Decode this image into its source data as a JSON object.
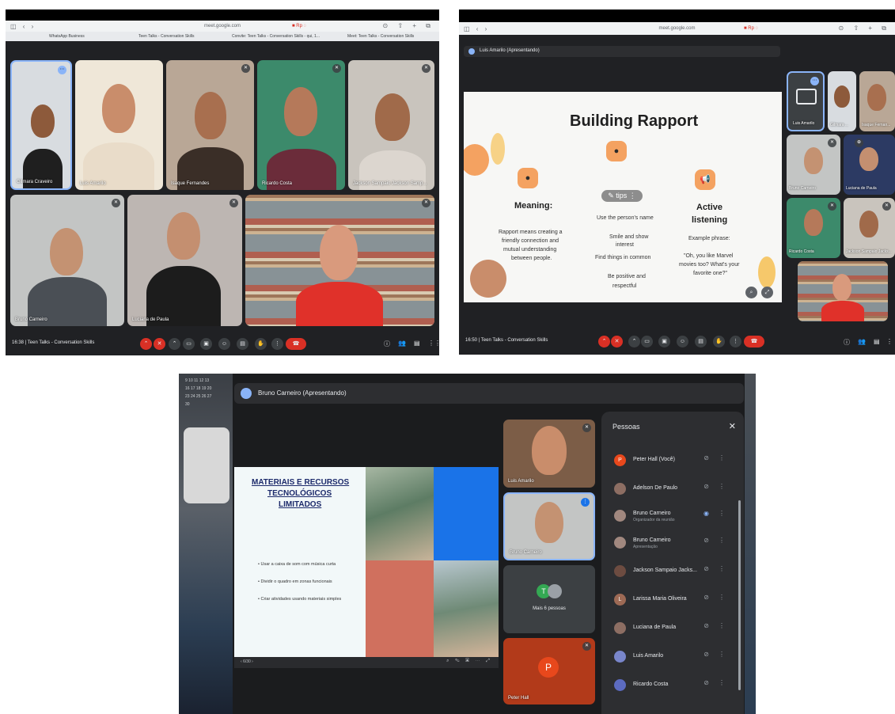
{
  "screen1": {
    "url": "meet.google.com",
    "rec_label": "■ Rp ◌",
    "tabs": [
      "WhatsApp Business",
      "Teen Talks - Conversation Skills",
      "Convite: Teen Talks - Conversation Skills - qui, 1...",
      "Meet: Teen Talks - Conversation Skills"
    ],
    "participants": [
      "Gilmara Craveiro",
      "Luis Amarilo",
      "Isaque Fernandes",
      "Ricardo Costa",
      "Jackson Sampaio Jackson Samp...",
      "Bruno Carneiro",
      "Luciana de Paula"
    ],
    "time_title": "16:38 | Teen Talks - Conversation Skills"
  },
  "screen2": {
    "url": "meet.google.com",
    "rec_label": "■ Rp ◌",
    "presenter": "Luis Amarilo (Apresentando)",
    "slide": {
      "title": "Building Rapport",
      "meaning_heading": "Meaning:",
      "meaning_text": [
        "Rapport means creating a",
        "friendly connection and",
        "mutual understanding",
        "between people."
      ],
      "tips_label": "tips",
      "tips": [
        "Use the person's name",
        "Smile and show",
        "interest",
        "Find things in common",
        "Be positive and",
        "respectful"
      ],
      "active_heading": [
        "Active",
        "listening"
      ],
      "example_label": "Example phrase:",
      "example_text": [
        "\"Oh, you like Marvel",
        "movies too? What's your",
        "favorite one?\""
      ]
    },
    "participants": [
      "Luis Amarilo",
      "Gilmara ...",
      "Isaque Fernan...",
      "Bruno Carneiro",
      "Luciana de Paula",
      "Ricardo Costa",
      "Jackson Sampaio Jacks..."
    ],
    "time_title": "16:50 | Teen Talks - Conversation Skills"
  },
  "screen3": {
    "calendar_rows": [
      "9  10  11  12  13",
      "16  17  18  19  20",
      "23  24  25  26  27",
      "30"
    ],
    "presenter": "Bruno Carneiro (Apresentando)",
    "slide": {
      "title": [
        "MATERIAIS E RECURSOS",
        "TECNOLÓGICOS",
        "LIMITADOS"
      ],
      "bullets": [
        "Usar a caixa de som com música curta",
        "Dividir o quadro em zonas funcionais",
        "Criar atividades usando materiais simples"
      ],
      "page": "6/30"
    },
    "side_tiles": [
      "Luis Amarilo",
      "Bruno Carneiro",
      "Mais 6 pessoas",
      "Peter Hall"
    ],
    "more_initial": "T",
    "peter_initial": "P",
    "people_panel": {
      "title": "Pessoas",
      "rows": [
        {
          "name": "Peter Hall (Você)",
          "sub": "",
          "initial": "P"
        },
        {
          "name": "Adelson De Paulo",
          "sub": "",
          "initial": ""
        },
        {
          "name": "Bruno Carneiro",
          "sub": "Organizador da reunião",
          "initial": ""
        },
        {
          "name": "Bruno Carneiro",
          "sub": "Apresentação",
          "initial": ""
        },
        {
          "name": "Jackson Sampaio Jacks...",
          "sub": "",
          "initial": ""
        },
        {
          "name": "Larissa Maria Oliveira",
          "sub": "",
          "initial": "L"
        },
        {
          "name": "Luciana de Paula",
          "sub": "",
          "initial": ""
        },
        {
          "name": "Luis Amarilo",
          "sub": "",
          "initial": ""
        },
        {
          "name": "Ricardo Costa",
          "sub": "",
          "initial": ""
        }
      ]
    }
  },
  "colors": {
    "meet_dark": "#202124",
    "end_call": "#d93025",
    "slide_orange": "#f4a261",
    "slide_blue": "#1a73e8",
    "slide_red": "#d0705e",
    "panel": "#2d2e31"
  }
}
